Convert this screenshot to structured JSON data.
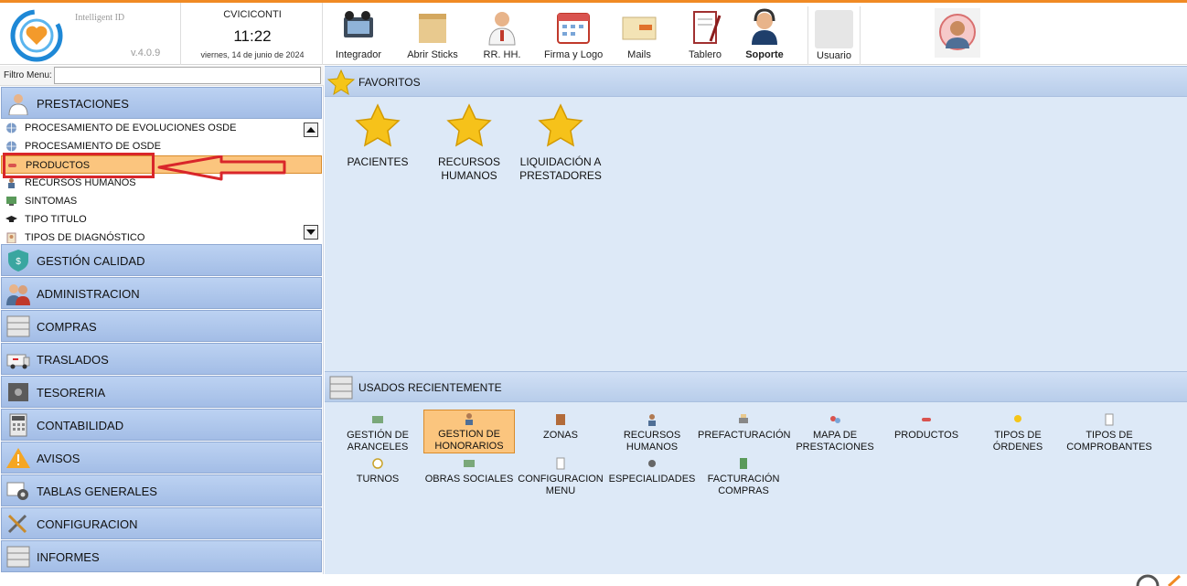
{
  "header": {
    "brand": "Intelligent ID",
    "version": "v.4.0.9",
    "user": "CVICICONTI",
    "time": "11:22",
    "date": "viernes, 14 de junio de 2024",
    "tools": [
      {
        "label": "Integrador",
        "icon": "film-icon"
      },
      {
        "label": "Abrir Sticks",
        "icon": "sticky-note-icon"
      },
      {
        "label": "RR. HH.",
        "icon": "doctor-icon"
      },
      {
        "label": "Firma y Logo",
        "icon": "calendar-icon"
      },
      {
        "label": "Mails",
        "icon": "mail-icon"
      },
      {
        "label": "Tablero",
        "icon": "board-icon"
      },
      {
        "label": "Soporte",
        "icon": "support-icon"
      }
    ],
    "usuario_label": "Usuario"
  },
  "sidebar": {
    "filter_label": "Filtro Menu:",
    "filter_value": "",
    "sections": [
      {
        "label": "PRESTACIONES",
        "icon": "doctor-icon"
      },
      {
        "label": "GESTIÓN CALIDAD",
        "icon": "shield-icon"
      },
      {
        "label": "ADMINISTRACION",
        "icon": "users-icon"
      },
      {
        "label": "COMPRAS",
        "icon": "cabinet-icon"
      },
      {
        "label": "TRASLADOS",
        "icon": "ambulance-icon"
      },
      {
        "label": "TESORERIA",
        "icon": "safe-icon"
      },
      {
        "label": "CONTABILIDAD",
        "icon": "calculator-icon"
      },
      {
        "label": "AVISOS",
        "icon": "warning-icon"
      },
      {
        "label": "TABLAS GENERALES",
        "icon": "gear-icon"
      },
      {
        "label": "CONFIGURACION",
        "icon": "tools-icon"
      },
      {
        "label": "INFORMES",
        "icon": "cabinet-icon"
      }
    ],
    "prestaciones_items": [
      {
        "label": "PROCESAMIENTO DE EVOLUCIONES OSDE",
        "icon": "globe-icon"
      },
      {
        "label": "PROCESAMIENTO DE OSDE",
        "icon": "globe-icon"
      },
      {
        "label": "PRODUCTOS",
        "icon": "pill-icon"
      },
      {
        "label": "RECURSOS HUMANOS",
        "icon": "person-icon"
      },
      {
        "label": "SINTOMAS",
        "icon": "monitor-icon"
      },
      {
        "label": "TIPO TITULO",
        "icon": "graduation-cap-icon"
      },
      {
        "label": "TIPOS DE DIAGNÓSTICO",
        "icon": "clipboard-icon"
      }
    ]
  },
  "favorites": {
    "title": "FAVORITOS",
    "items": [
      "PACIENTES",
      "RECURSOS HUMANOS",
      "LIQUIDACIÓN A PRESTADORES"
    ]
  },
  "recent": {
    "title": "USADOS RECIENTEMENTE",
    "items": [
      {
        "label": "GESTIÓN DE ARANCELES",
        "icon": "money-icon"
      },
      {
        "label": "GESTION DE HONORARIOS",
        "icon": "person-icon"
      },
      {
        "label": "ZONAS",
        "icon": "map-icon"
      },
      {
        "label": "RECURSOS HUMANOS",
        "icon": "person-icon"
      },
      {
        "label": "PREFACTURACIÓN",
        "icon": "printer-icon"
      },
      {
        "label": "MAPA DE PRESTACIONES",
        "icon": "map-icon"
      },
      {
        "label": "PRODUCTOS",
        "icon": "pill-icon"
      },
      {
        "label": "TIPOS DE ÓRDENES",
        "icon": "pin-icon"
      },
      {
        "label": "TIPOS DE COMPROBANTES",
        "icon": "document-icon"
      },
      {
        "label": "TURNOS",
        "icon": "clock-icon"
      },
      {
        "label": "OBRAS SOCIALES",
        "icon": "money-icon"
      },
      {
        "label": "CONFIGURACION MENU",
        "icon": "document-icon"
      },
      {
        "label": "ESPECIALIDADES",
        "icon": "stethoscope-icon"
      },
      {
        "label": "FACTURACIÓN COMPRAS",
        "icon": "invoice-icon"
      }
    ]
  },
  "colors": {
    "accent_orange": "#f08a24",
    "selected": "#fbc57e",
    "section_blue": "#a3bde6",
    "main_bg": "#dde9f7",
    "highlight_red": "#d9262a"
  }
}
